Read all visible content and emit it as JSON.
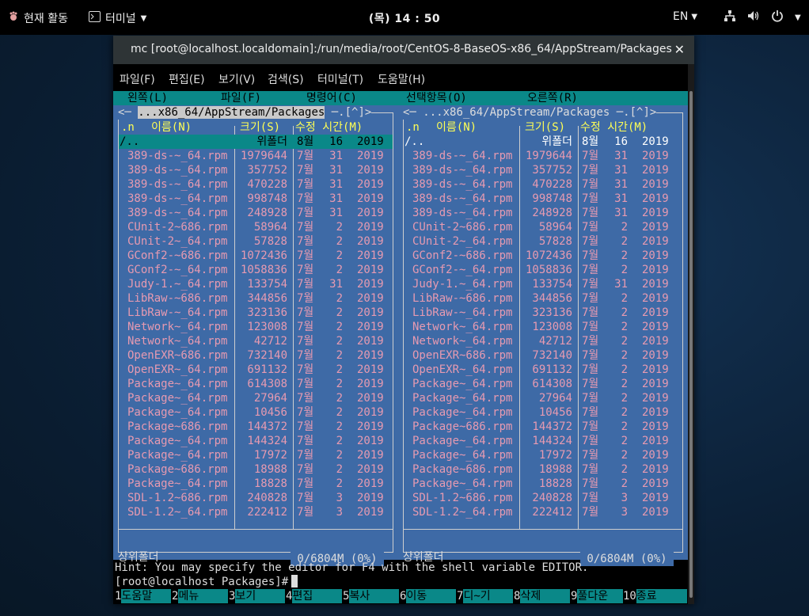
{
  "topbar": {
    "activities": "현재 활동",
    "app": "터미널",
    "clock": "(목) 14 : 50",
    "lang": "EN"
  },
  "window": {
    "title": "mc [root@localhost.localdomain]:/run/media/root/CentOS-8-BaseOS-x86_64/AppStream/Packages"
  },
  "menubar": [
    "파일(F)",
    "편집(E)",
    "보기(V)",
    "검색(S)",
    "터미널(T)",
    "도움말(H)"
  ],
  "mcmenu": [
    "왼쪽(L)",
    "파일(F)",
    "명령어(C)",
    "선택항목(O)",
    "오른쪽(R)"
  ],
  "panels": {
    "path": "...x86_64/AppStream/Packages",
    "path_suffix": ".[^]>",
    "col_n": ".n",
    "col_name": "이름(N)",
    "col_size": "크기(S)",
    "col_mtime": "수정 시간(M)",
    "updir": {
      "name": "/..",
      "size": "위폴더",
      "month": "8월",
      "day": "16",
      "year": "2019"
    },
    "files": [
      {
        "name": "389-ds-~_64.rpm",
        "size": "1979644",
        "month": "7월",
        "day": "31",
        "year": "2019"
      },
      {
        "name": "389-ds-~_64.rpm",
        "size": "357752",
        "month": "7월",
        "day": "31",
        "year": "2019"
      },
      {
        "name": "389-ds-~_64.rpm",
        "size": "470228",
        "month": "7월",
        "day": "31",
        "year": "2019"
      },
      {
        "name": "389-ds-~_64.rpm",
        "size": "998748",
        "month": "7월",
        "day": "31",
        "year": "2019"
      },
      {
        "name": "389-ds-~_64.rpm",
        "size": "248928",
        "month": "7월",
        "day": "31",
        "year": "2019"
      },
      {
        "name": "CUnit-2~686.rpm",
        "size": "58964",
        "month": "7월",
        "day": "2",
        "year": "2019"
      },
      {
        "name": "CUnit-2~_64.rpm",
        "size": "57828",
        "month": "7월",
        "day": "2",
        "year": "2019"
      },
      {
        "name": "GConf2-~686.rpm",
        "size": "1072436",
        "month": "7월",
        "day": "2",
        "year": "2019"
      },
      {
        "name": "GConf2-~_64.rpm",
        "size": "1058836",
        "month": "7월",
        "day": "2",
        "year": "2019"
      },
      {
        "name": "Judy-1.~_64.rpm",
        "size": "133754",
        "month": "7월",
        "day": "31",
        "year": "2019"
      },
      {
        "name": "LibRaw-~686.rpm",
        "size": "344856",
        "month": "7월",
        "day": "2",
        "year": "2019"
      },
      {
        "name": "LibRaw-~_64.rpm",
        "size": "323136",
        "month": "7월",
        "day": "2",
        "year": "2019"
      },
      {
        "name": "Network~_64.rpm",
        "size": "123008",
        "month": "7월",
        "day": "2",
        "year": "2019"
      },
      {
        "name": "Network~_64.rpm",
        "size": "42712",
        "month": "7월",
        "day": "2",
        "year": "2019"
      },
      {
        "name": "OpenEXR~686.rpm",
        "size": "732140",
        "month": "7월",
        "day": "2",
        "year": "2019"
      },
      {
        "name": "OpenEXR~_64.rpm",
        "size": "691132",
        "month": "7월",
        "day": "2",
        "year": "2019"
      },
      {
        "name": "Package~_64.rpm",
        "size": "614308",
        "month": "7월",
        "day": "2",
        "year": "2019"
      },
      {
        "name": "Package~_64.rpm",
        "size": "27964",
        "month": "7월",
        "day": "2",
        "year": "2019"
      },
      {
        "name": "Package~_64.rpm",
        "size": "10456",
        "month": "7월",
        "day": "2",
        "year": "2019"
      },
      {
        "name": "Package~686.rpm",
        "size": "144372",
        "month": "7월",
        "day": "2",
        "year": "2019"
      },
      {
        "name": "Package~_64.rpm",
        "size": "144324",
        "month": "7월",
        "day": "2",
        "year": "2019"
      },
      {
        "name": "Package~_64.rpm",
        "size": "17972",
        "month": "7월",
        "day": "2",
        "year": "2019"
      },
      {
        "name": "Package~686.rpm",
        "size": "18988",
        "month": "7월",
        "day": "2",
        "year": "2019"
      },
      {
        "name": "Package~_64.rpm",
        "size": "18828",
        "month": "7월",
        "day": "2",
        "year": "2019"
      },
      {
        "name": "SDL-1.2~686.rpm",
        "size": "240828",
        "month": "7월",
        "day": "3",
        "year": "2019"
      },
      {
        "name": "SDL-1.2~_64.rpm",
        "size": "222412",
        "month": "7월",
        "day": "3",
        "year": "2019"
      }
    ],
    "status": "상위폴더",
    "usage": "0/6804M (0%)"
  },
  "hint": "Hint: You may specify the editor for F4 with the shell variable EDITOR.",
  "prompt": "[root@localhost Packages]#",
  "fkeys": [
    {
      "num": "1",
      "label": "도움말"
    },
    {
      "num": "2",
      "label": "메뉴"
    },
    {
      "num": "3",
      "label": "보기"
    },
    {
      "num": "4",
      "label": "편집"
    },
    {
      "num": "5",
      "label": "복사"
    },
    {
      "num": "6",
      "label": "이동"
    },
    {
      "num": "7",
      "label": "디~기"
    },
    {
      "num": "8",
      "label": "삭제"
    },
    {
      "num": "9",
      "label": "풀다운"
    },
    {
      "num": "10",
      "label": "종료"
    }
  ]
}
